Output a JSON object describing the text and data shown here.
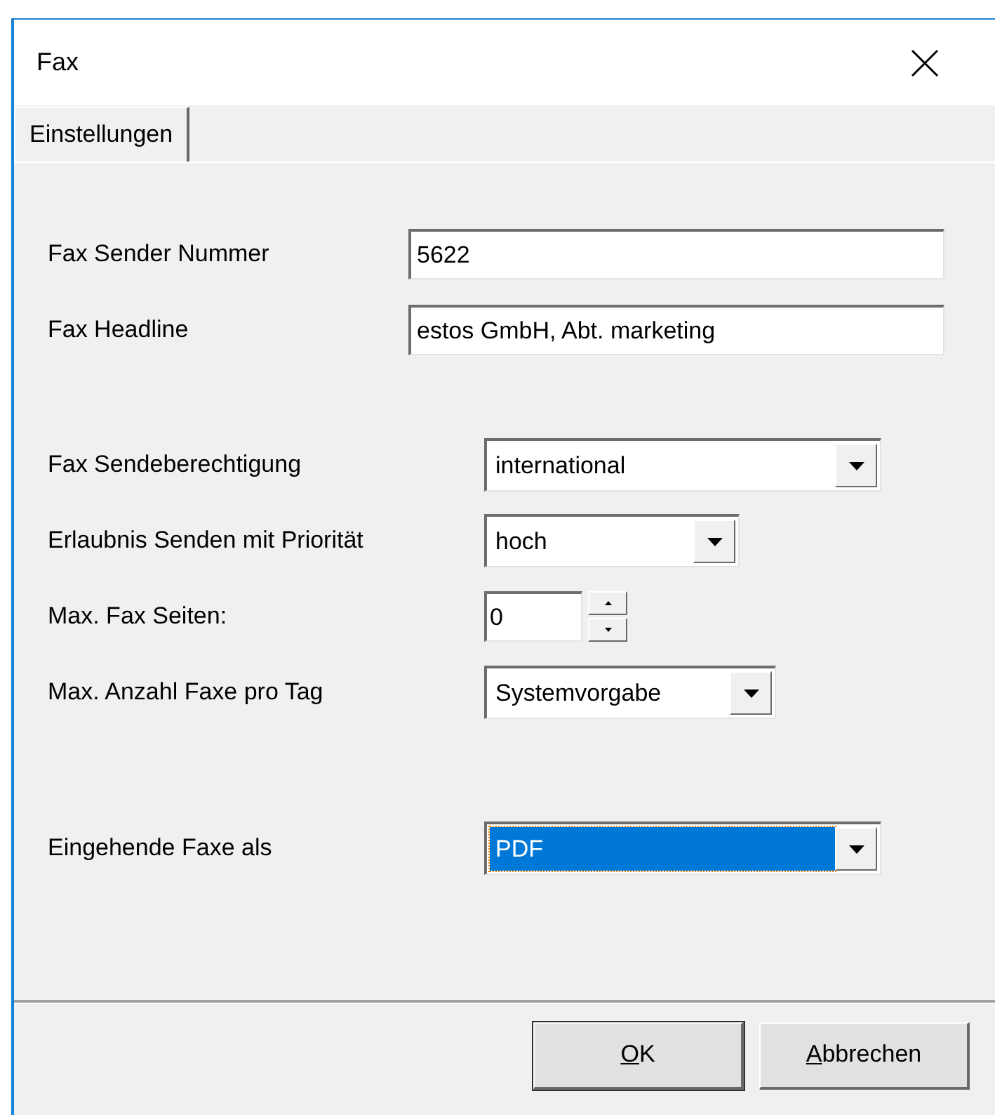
{
  "window": {
    "title": "Fax"
  },
  "tabs": [
    {
      "label": "Einstellungen",
      "selected": true
    }
  ],
  "sections": [
    [
      {
        "kind": "text",
        "label": "Fax Sender Nummer",
        "value": "5622"
      },
      {
        "kind": "text",
        "label": "Fax Headline",
        "value": "estos GmbH, Abt. marketing"
      }
    ],
    [
      {
        "kind": "dropdown",
        "label": "Fax Sendeberechtigung",
        "value": "international",
        "focused": false
      },
      {
        "kind": "dropdown",
        "label": "Erlaubnis Senden mit Priorität",
        "value": "hoch",
        "focused": false
      },
      {
        "kind": "spinner",
        "label": "Max. Fax Seiten:",
        "value": "0"
      },
      {
        "kind": "dropdown",
        "label": "Max. Anzahl Faxe pro Tag",
        "value": "Systemvorgabe",
        "focused": false
      }
    ],
    [
      {
        "kind": "dropdown",
        "label": "Eingehende Faxe als",
        "value": "PDF",
        "focused": true
      }
    ]
  ],
  "buttons": [
    {
      "mnemonic": "O",
      "rest": "K",
      "default": true
    },
    {
      "mnemonic": "A",
      "rest": "bbrechen",
      "default": false
    }
  ]
}
